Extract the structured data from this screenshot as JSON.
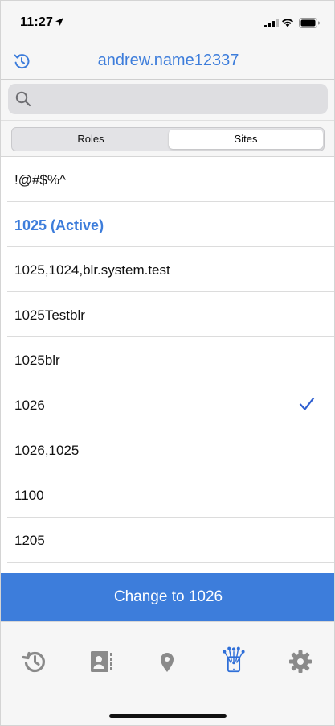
{
  "status_bar": {
    "time": "11:27",
    "icons": [
      "location-arrow-icon",
      "cellular-signal-icon",
      "wifi-icon",
      "battery-icon"
    ]
  },
  "nav": {
    "title": "andrew.name12337",
    "left_icon": "refresh-icon"
  },
  "search": {
    "placeholder": "",
    "value": ""
  },
  "segments": {
    "items": [
      {
        "label": "Roles",
        "selected": false
      },
      {
        "label": "Sites",
        "selected": true
      }
    ]
  },
  "sites": {
    "items": [
      {
        "label": "!@#$%^"
      },
      {
        "label": "1025 (Active)",
        "active": true
      },
      {
        "label": "1025,1024,blr.system.test"
      },
      {
        "label": "1025Testblr"
      },
      {
        "label": "1025blr"
      },
      {
        "label": "1026",
        "checked": true
      },
      {
        "label": "1026,1025"
      },
      {
        "label": "1100"
      },
      {
        "label": "1205"
      }
    ]
  },
  "action": {
    "label": "Change to 1026"
  },
  "tab_bar": {
    "tabs": [
      {
        "icon": "history-icon",
        "selected": false
      },
      {
        "icon": "contacts-icon",
        "selected": false
      },
      {
        "icon": "location-pin-icon",
        "selected": false
      },
      {
        "icon": "network-phone-icon",
        "selected": true
      },
      {
        "icon": "gear-icon",
        "selected": false
      }
    ]
  },
  "colors": {
    "accent": "#3d7ddb",
    "tab_inactive": "#8a8a8a",
    "tab_active": "#2f6fd8"
  }
}
